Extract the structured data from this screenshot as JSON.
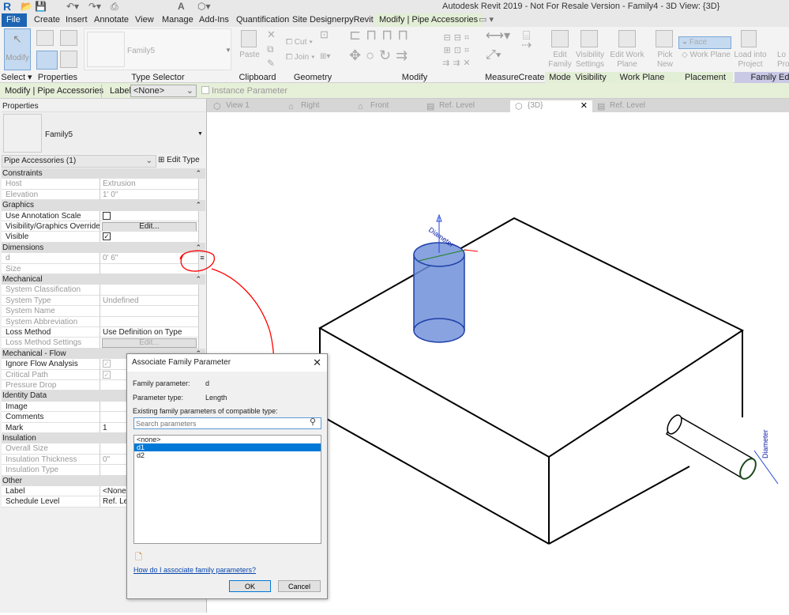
{
  "app": {
    "title": "Autodesk Revit 2019 - Not For Resale Version - Family4 - 3D View: {3D}",
    "logo": "R"
  },
  "ribbon_tabs": [
    "File",
    "Create",
    "Insert",
    "Annotate",
    "View",
    "Manage",
    "Add-Ins",
    "Quantification",
    "Site Designer",
    "pyRevit",
    "Modify | Pipe Accessories"
  ],
  "ribbon": {
    "modify_btn": "Modify",
    "type_selector_value": "Family5",
    "clipboard": {
      "paste": "Paste"
    },
    "geometry": {
      "cut": "Cut",
      "join": "Join"
    },
    "mode": {
      "edit_family": "Edit Family"
    },
    "visibility": {
      "visibility_settings": "Visibility Settings"
    },
    "work_plane": {
      "edit_work_plane": "Edit Work Plane",
      "pick_new": "Pick New"
    },
    "placement": {
      "face": "Face",
      "work_plane": "Work Plane"
    },
    "family_editor": {
      "load_into_project": "Load into Project",
      "load_close": "Lo Projec"
    },
    "panels": [
      "Select ▾",
      "Properties",
      "Type Selector",
      "Clipboard",
      "Geometry",
      "Modify",
      "Measure",
      "Create",
      "Mode",
      "Visibility",
      "Work Plane",
      "Placement",
      "Family Ed"
    ]
  },
  "options_bar": {
    "context": "Modify | Pipe Accessories",
    "label_label": "Label:",
    "label_value": "<None>",
    "instance_parameter": "Instance Parameter"
  },
  "properties": {
    "title": "Properties",
    "type_name": "Family5",
    "filter": "Pipe Accessories (1)",
    "edit_type": "Edit Type",
    "rows": [
      {
        "kind": "group",
        "name": "Constraints"
      },
      {
        "kind": "data",
        "name": "Host",
        "value": "Extrusion",
        "disabled": true
      },
      {
        "kind": "data",
        "name": "Elevation",
        "value": "1'  0\"",
        "disabled": true
      },
      {
        "kind": "group",
        "name": "Graphics"
      },
      {
        "kind": "data",
        "name": "Use Annotation Scale",
        "value": "checkbox-off"
      },
      {
        "kind": "data",
        "name": "Visibility/Graphics Overrides",
        "value": "Edit..."
      },
      {
        "kind": "data",
        "name": "Visible",
        "value": "checkbox-on"
      },
      {
        "kind": "group",
        "name": "Dimensions"
      },
      {
        "kind": "data",
        "name": "d",
        "value": "0'  6\"",
        "disabled": true,
        "assoc": true
      },
      {
        "kind": "data",
        "name": "Size",
        "value": "",
        "disabled": true
      },
      {
        "kind": "group",
        "name": "Mechanical"
      },
      {
        "kind": "data",
        "name": "System Classification",
        "value": "",
        "disabled": true
      },
      {
        "kind": "data",
        "name": "System Type",
        "value": "Undefined",
        "disabled": true
      },
      {
        "kind": "data",
        "name": "System Name",
        "value": "",
        "disabled": true
      },
      {
        "kind": "data",
        "name": "System Abbreviation",
        "value": "",
        "disabled": true
      },
      {
        "kind": "data",
        "name": "Loss Method",
        "value": "Use Definition on Type"
      },
      {
        "kind": "data",
        "name": "Loss Method Settings",
        "value": "Edit...",
        "disabled": true
      },
      {
        "kind": "group",
        "name": "Mechanical - Flow"
      },
      {
        "kind": "data",
        "name": "Ignore Flow Analysis",
        "value": "checkbox-on-gray"
      },
      {
        "kind": "data",
        "name": "Critical Path",
        "value": "checkbox-on-gray",
        "disabled": true
      },
      {
        "kind": "data",
        "name": "Pressure Drop",
        "value": "",
        "disabled": true
      },
      {
        "kind": "group",
        "name": "Identity Data"
      },
      {
        "kind": "data",
        "name": "Image",
        "value": ""
      },
      {
        "kind": "data",
        "name": "Comments",
        "value": ""
      },
      {
        "kind": "data",
        "name": "Mark",
        "value": "1"
      },
      {
        "kind": "group",
        "name": "Insulation"
      },
      {
        "kind": "data",
        "name": "Overall Size",
        "value": "",
        "disabled": true
      },
      {
        "kind": "data",
        "name": "Insulation Thickness",
        "value": "0\"",
        "disabled": true
      },
      {
        "kind": "data",
        "name": "Insulation Type",
        "value": "",
        "disabled": true
      },
      {
        "kind": "group",
        "name": "Other"
      },
      {
        "kind": "data",
        "name": "Label",
        "value": "<None>"
      },
      {
        "kind": "data",
        "name": "Schedule Level",
        "value": "Ref. Level"
      }
    ]
  },
  "view_tabs": [
    {
      "label": "View 1",
      "icon": "3d-view-icon"
    },
    {
      "label": "Right",
      "icon": "elevation-icon"
    },
    {
      "label": "Front",
      "icon": "elevation-icon"
    },
    {
      "label": "Ref. Level",
      "icon": "plan-icon"
    },
    {
      "label": "{3D}",
      "icon": "3d-view-icon",
      "active": true
    },
    {
      "label": "Ref. Level",
      "icon": "plan-icon"
    }
  ],
  "canvas": {
    "dim_label_top": "Diameter",
    "dim_label_side": "Diameter",
    "cylinder_color": "#6f8fd8",
    "annotation_color": "#ff0000"
  },
  "dialog": {
    "title": "Associate Family Parameter",
    "family_parameter_label": "Family parameter:",
    "family_parameter_value": "d",
    "parameter_type_label": "Parameter type:",
    "parameter_type_value": "Length",
    "existing_label": "Existing family parameters of compatible type:",
    "search_placeholder": "Search parameters",
    "list": [
      "<none>",
      "d1",
      "d2"
    ],
    "selected": "d1",
    "help_link": "How do I associate family parameters?",
    "ok": "OK",
    "cancel": "Cancel"
  }
}
